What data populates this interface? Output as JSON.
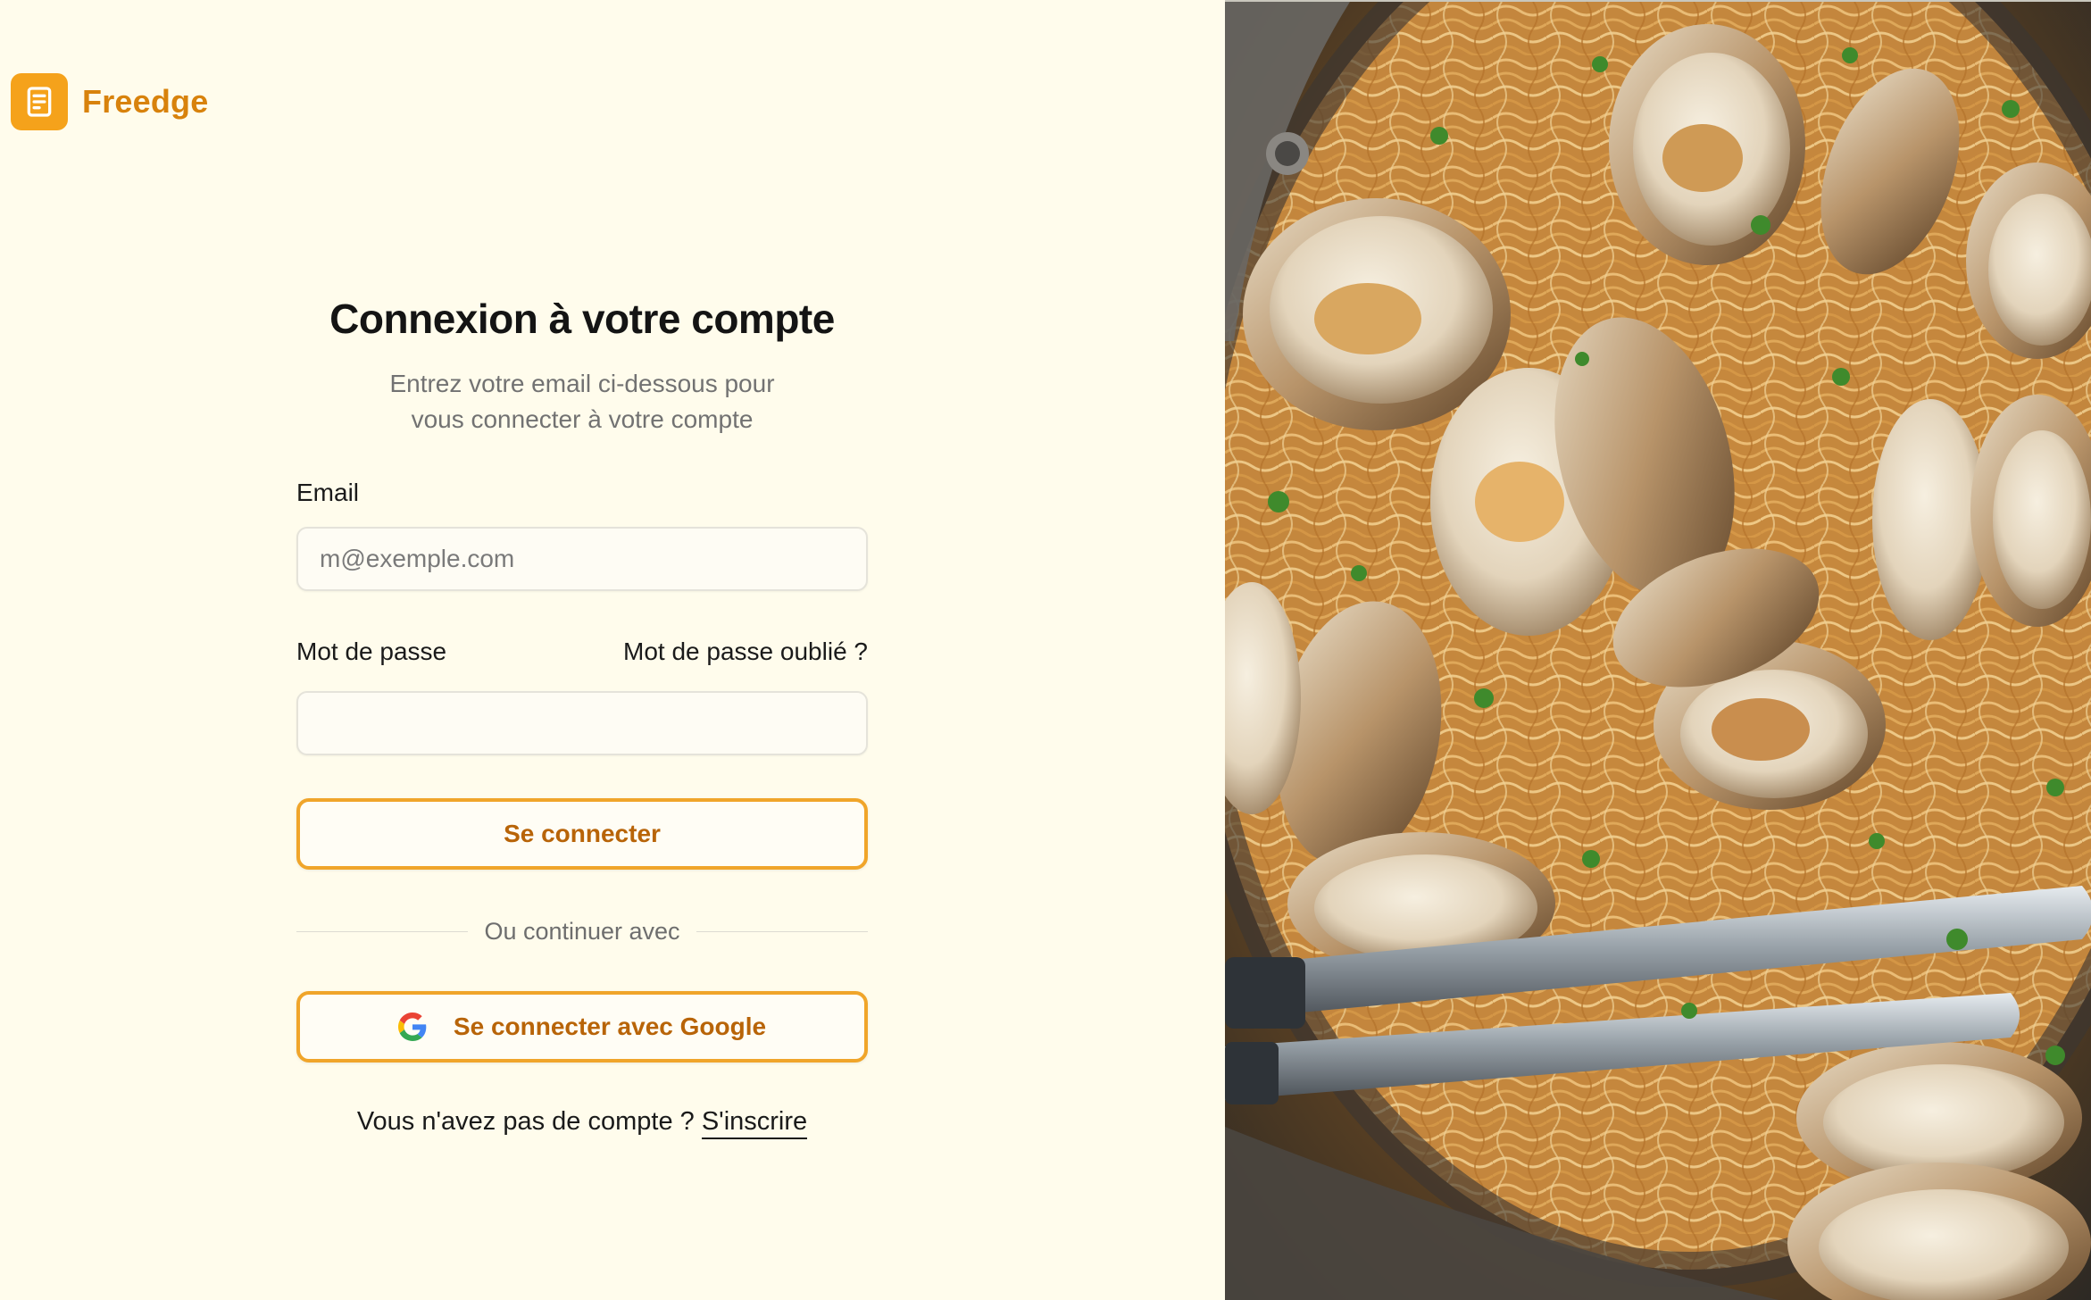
{
  "brand": {
    "name": "Freedge",
    "icon": "recipe-book-icon",
    "color": "#f5a21b"
  },
  "login": {
    "title": "Connexion à votre compte",
    "subtitle_line1": "Entrez votre email ci-dessous pour",
    "subtitle_line2": "vous connecter à votre compte",
    "email_label": "Email",
    "email_placeholder": "m@exemple.com",
    "email_value": "",
    "password_label": "Mot de passe",
    "password_value": "",
    "forgot_link": "Mot de passe oublié ?",
    "submit_label": "Se connecter",
    "divider_text": "Ou continuer avec",
    "google_label": "Se connecter avec Google",
    "signup_prompt": "Vous n'avez pas de compte ?",
    "signup_link": "S'inscrire"
  },
  "hero_image": {
    "subject": "Spaghetti with clams and parsley in a pan with tongs"
  },
  "colors": {
    "background": "#fffcec",
    "accent": "#f0a52a",
    "accent_text": "#b86408"
  }
}
